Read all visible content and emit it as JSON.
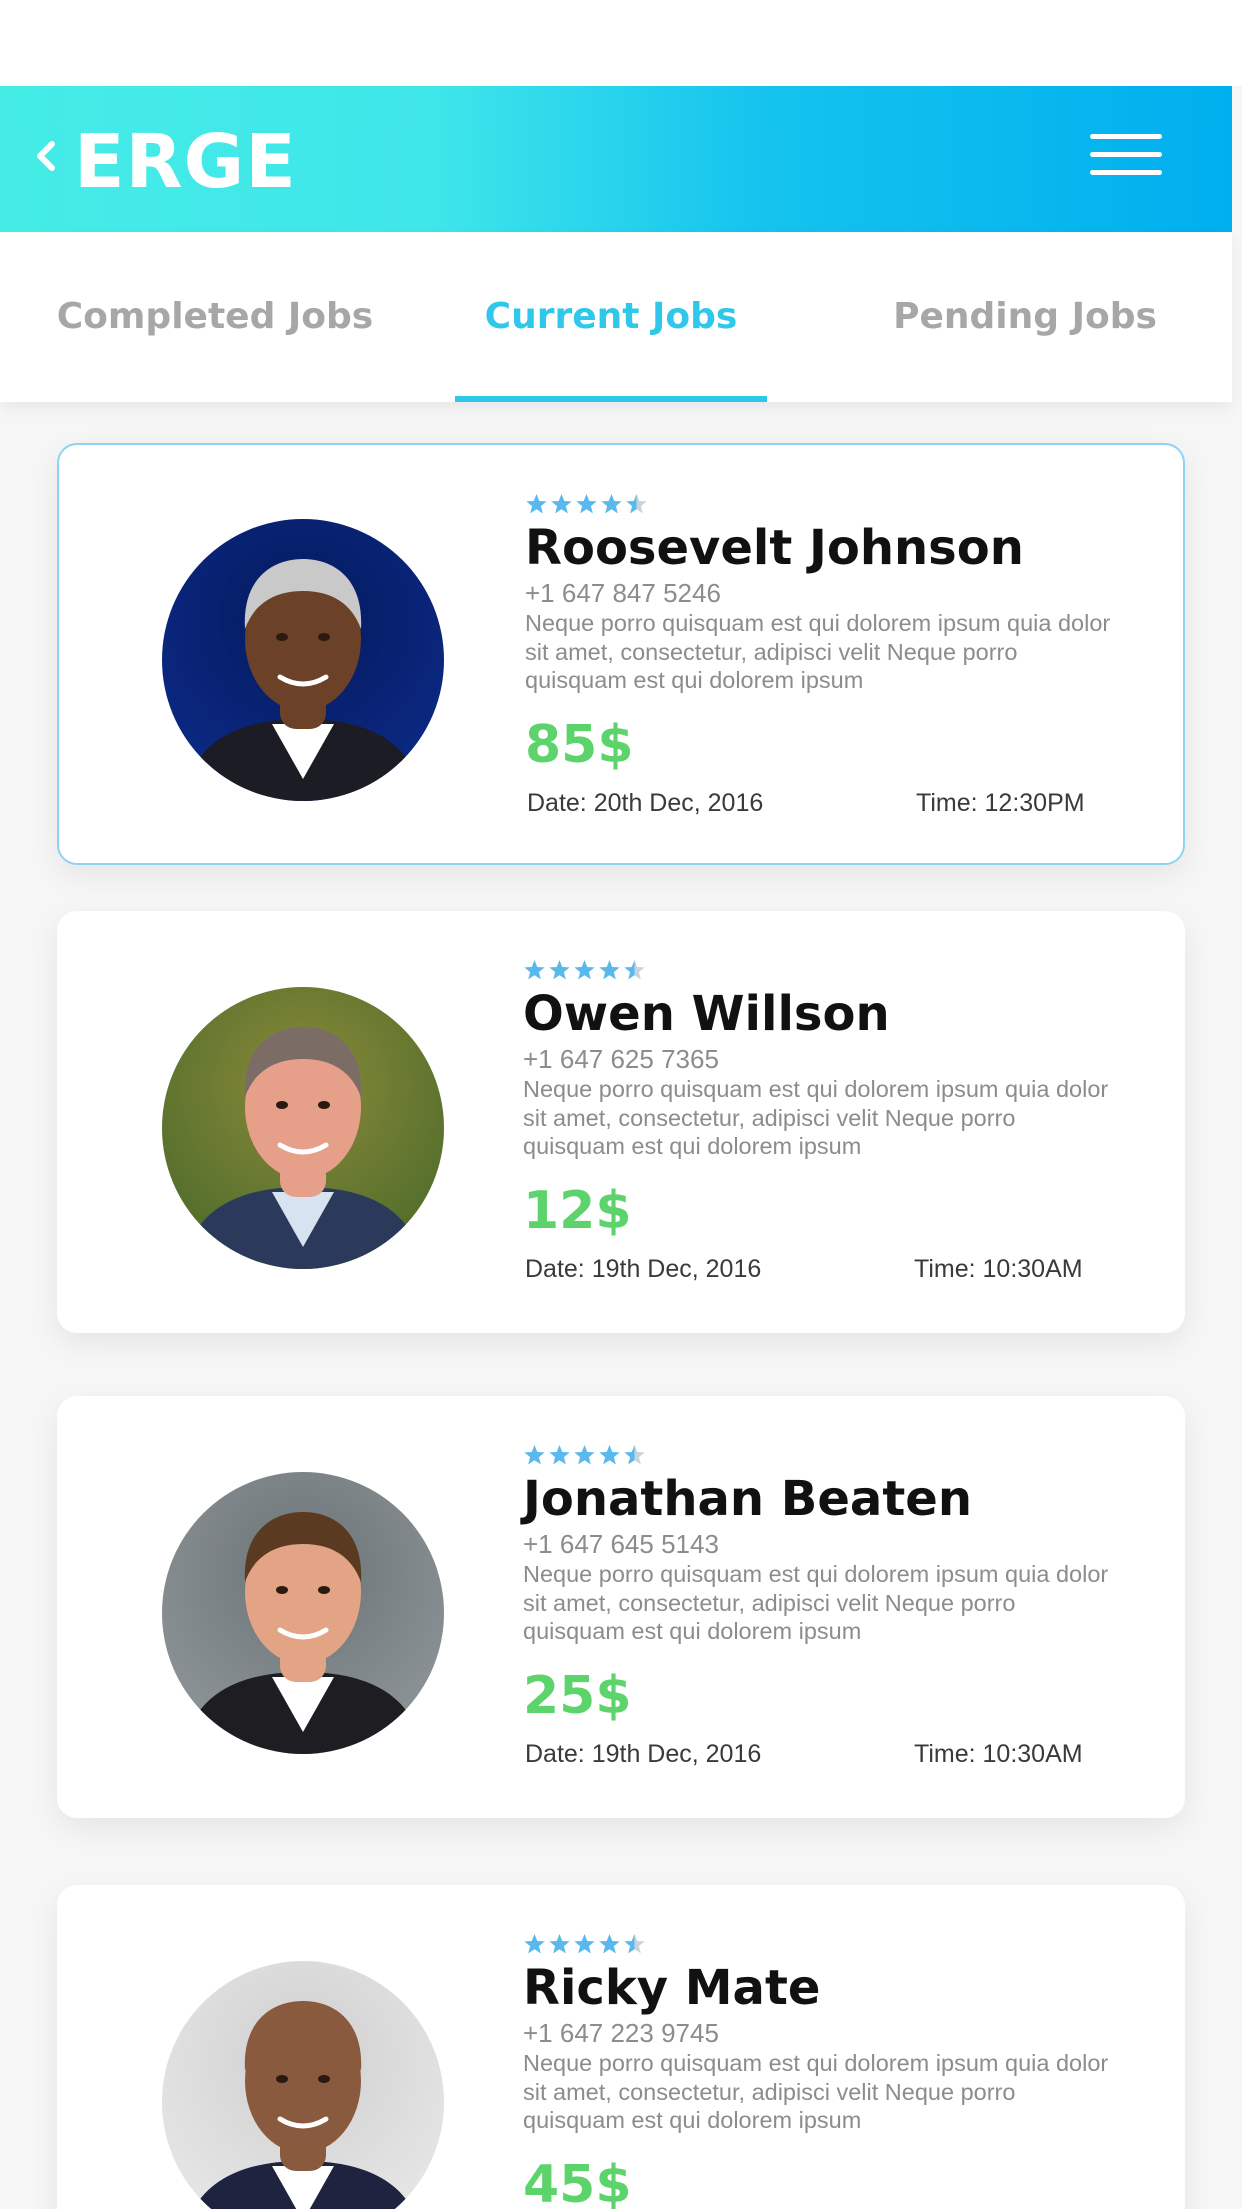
{
  "header": {
    "brand": "ERGE",
    "gradient_start": "#45ece6",
    "gradient_end": "#00afee",
    "back_icon": "chevron-left-icon",
    "menu_icon": "hamburger-menu-icon"
  },
  "tabs": [
    {
      "label": "Completed Jobs",
      "active": false
    },
    {
      "label": "Current Jobs",
      "active": true
    },
    {
      "label": "Pending Jobs",
      "active": false
    }
  ],
  "colors": {
    "accent": "#2fc7ea",
    "price": "#5dd36b",
    "star": "#5ab9ec"
  },
  "jobs": [
    {
      "rating": 4.5,
      "name": "Roosevelt  Johnson",
      "phone": "+1 647 847 5246",
      "description": "Neque porro quisquam est qui dolorem ipsum quia dolor sit amet, consectetur, adipisci velit Neque porro quisquam est qui dolorem ipsum",
      "price": "85$",
      "date": "Date: 20th Dec, 2016",
      "time": "Time: 12:30PM",
      "selected": true
    },
    {
      "rating": 4.5,
      "name": "Owen Willson",
      "phone": "+1 647 625 7365",
      "description": "Neque porro quisquam est qui dolorem ipsum quia dolor sit amet, consectetur, adipisci velit Neque porro quisquam est qui dolorem ipsum",
      "price": "12$",
      "date": "Date: 19th Dec, 2016",
      "time": "Time: 10:30AM",
      "selected": false
    },
    {
      "rating": 4.5,
      "name": "Jonathan Beaten",
      "phone": "+1 647 645 5143",
      "description": "Neque porro quisquam est qui dolorem ipsum quia dolor sit amet, consectetur, adipisci velit Neque porro quisquam est qui dolorem ipsum",
      "price": "25$",
      "date": "Date: 19th Dec, 2016",
      "time": "Time: 10:30AM",
      "selected": false
    },
    {
      "rating": 4.5,
      "name": "Ricky Mate",
      "phone": "+1 647 223 9745",
      "description": "Neque porro quisquam est qui dolorem ipsum quia dolor sit amet, consectetur, adipisci velit Neque porro quisquam est qui dolorem ipsum",
      "price": "45$",
      "date": "",
      "time": "",
      "selected": false
    }
  ]
}
